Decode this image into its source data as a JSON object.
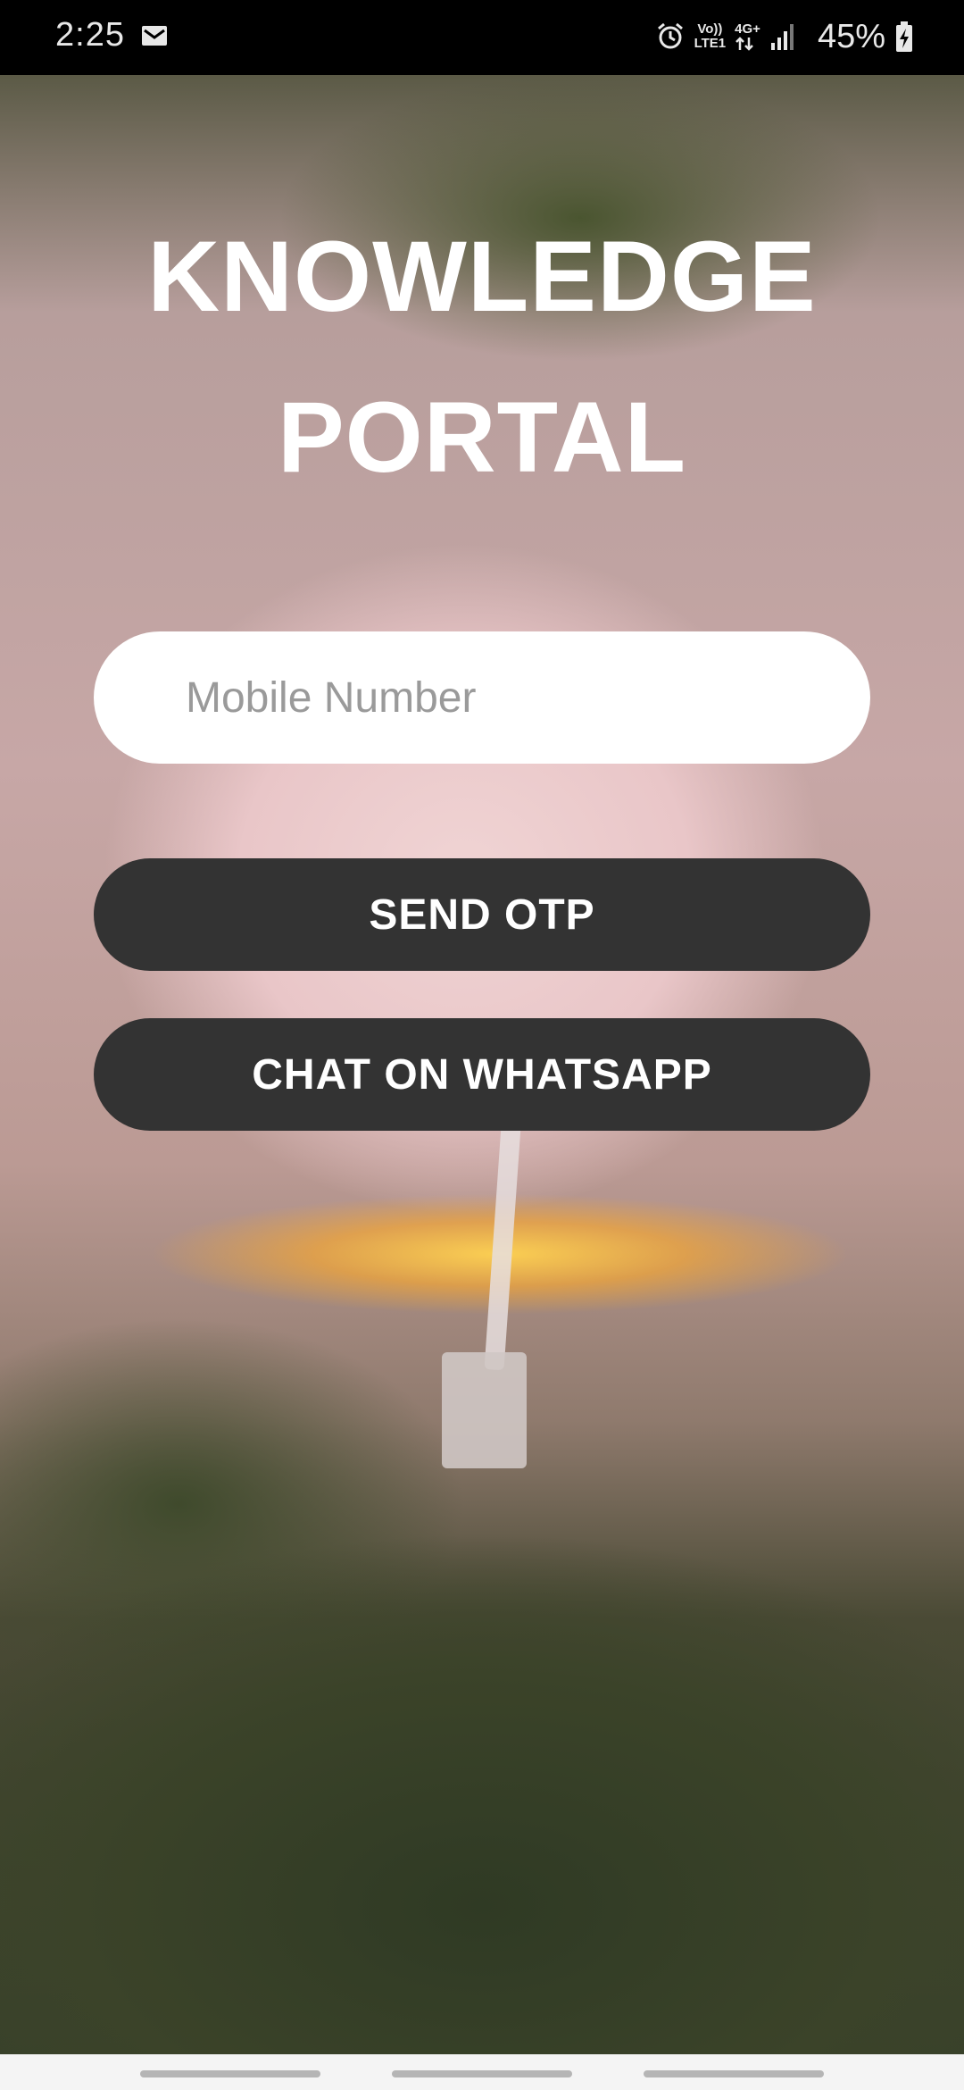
{
  "status_bar": {
    "time": "2:25",
    "network_top": "Vo))",
    "network_bottom": "LTE1",
    "data_type": "4G+",
    "battery_percent": "45%",
    "icons": [
      "gmail-icon",
      "alarm-icon",
      "data-arrows-icon",
      "signal-icon",
      "battery-charging-icon"
    ]
  },
  "app": {
    "title_line1": "KNOWLEDGE",
    "title_line2": "PORTAL"
  },
  "form": {
    "mobile_placeholder": "Mobile Number",
    "mobile_value": "",
    "send_otp_label": "SEND OTP",
    "whatsapp_label": "CHAT ON WHATSAPP"
  },
  "colors": {
    "button_bg": "#333333",
    "input_bg": "#ffffff",
    "title_text": "#ffffff"
  }
}
